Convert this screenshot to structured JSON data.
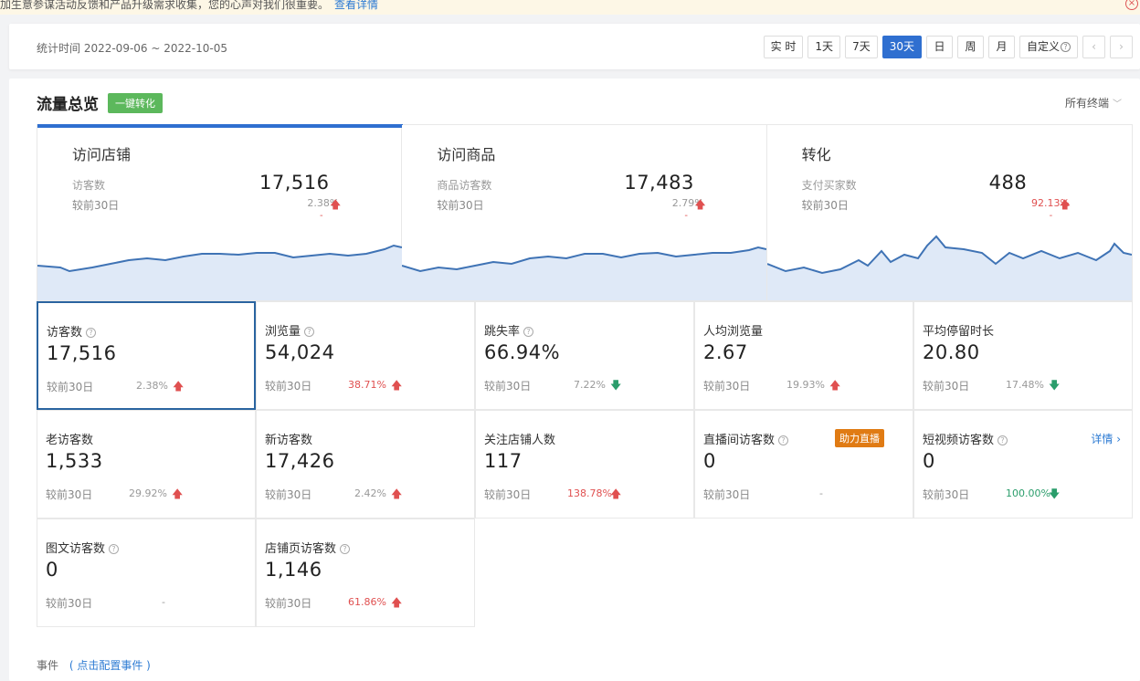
{
  "notice": {
    "text": "加生意参谋活动反馈和产品升级需求收集，您的心声对我们很重要。",
    "link": "查看详情"
  },
  "datebar": {
    "period_label": "统计时间 2022-09-06 ~ 2022-10-05",
    "buttons": [
      "实 时",
      "1天",
      "7天",
      "30天",
      "日",
      "周",
      "月",
      "自定义"
    ],
    "active_button": "30天"
  },
  "panel": {
    "title": "流量总览",
    "convert_button": "一键转化",
    "terminal": "所有终端"
  },
  "cards": [
    {
      "title": "访问店铺",
      "label": "访客数",
      "value": "17,516",
      "compare": "较前30日",
      "pct": "2.38%",
      "dash": "-"
    },
    {
      "title": "访问商品",
      "label": "商品访客数",
      "value": "17,483",
      "compare": "较前30日",
      "pct": "2.79%",
      "dash": "-"
    },
    {
      "title": "转化",
      "label": "支付买家数",
      "value": "488",
      "compare": "较前30日",
      "pct": "92.13%",
      "dash": "-"
    }
  ],
  "metrics": [
    {
      "label": "访客数",
      "value": "17,516",
      "compare": "较前30日",
      "pct": "2.38%",
      "trend": "up"
    },
    {
      "label": "浏览量",
      "value": "54,024",
      "compare": "较前30日",
      "pct": "38.71%",
      "trend": "up"
    },
    {
      "label": "跳失率",
      "value": "66.94%",
      "compare": "较前30日",
      "pct": "7.22%",
      "trend": "down"
    },
    {
      "label": "人均浏览量",
      "value": "2.67",
      "compare": "较前30日",
      "pct": "19.93%",
      "trend": "up"
    },
    {
      "label": "平均停留时长",
      "value": "20.80",
      "compare": "较前30日",
      "pct": "17.48%",
      "trend": "down"
    },
    {
      "label": "老访客数",
      "value": "1,533",
      "compare": "较前30日",
      "pct": "29.92%",
      "trend": "up"
    },
    {
      "label": "新访客数",
      "value": "17,426",
      "compare": "较前30日",
      "pct": "2.42%",
      "trend": "up"
    },
    {
      "label": "关注店铺人数",
      "value": "117",
      "compare": "较前30日",
      "pct": "138.78%",
      "trend": "up"
    },
    {
      "label": "直播间访客数",
      "value": "0",
      "compare": "较前30日",
      "pct": "-",
      "trend": "none",
      "badge": "助力直播"
    },
    {
      "label": "短视频访客数",
      "value": "0",
      "compare": "较前30日",
      "pct": "100.00%",
      "trend": "down",
      "link": "详情"
    },
    {
      "label": "图文访客数",
      "value": "0",
      "compare": "较前30日",
      "pct": "-",
      "trend": "none"
    },
    {
      "label": "店铺页访客数",
      "value": "1,146",
      "compare": "较前30日",
      "pct": "61.86%",
      "trend": "up"
    }
  ],
  "events": {
    "label": "事件",
    "config_link": "( 点击配置事件 )"
  },
  "colors": {
    "accent": "#2f6fd0",
    "up": "#e05050",
    "down": "#2a9d6b",
    "convert": "#5cb85c",
    "live_badge": "#e07b14"
  }
}
